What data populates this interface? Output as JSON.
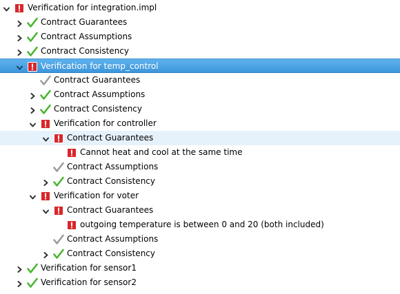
{
  "colors": {
    "selection": "#4aa3e4",
    "hover": "#e6f2fb",
    "error_red": "#d9262a",
    "check_green": "#48b52e",
    "check_gray": "#9c9c9c"
  },
  "rows": [
    {
      "label": "Verification for integration.impl",
      "icon": "error-icon",
      "twisty": "expanded",
      "depth": 0
    },
    {
      "label": "Contract Guarantees",
      "icon": "check-icon",
      "twisty": "collapsed",
      "depth": 1
    },
    {
      "label": "Contract Assumptions",
      "icon": "check-icon",
      "twisty": "collapsed",
      "depth": 1
    },
    {
      "label": "Contract Consistency",
      "icon": "check-icon",
      "twisty": "collapsed",
      "depth": 1
    },
    {
      "label": "Verification for temp_control",
      "icon": "error-icon",
      "twisty": "expanded",
      "depth": 1,
      "state": "selected"
    },
    {
      "label": "Contract Guarantees",
      "icon": "check-gray-icon",
      "twisty": "none",
      "depth": 2
    },
    {
      "label": "Contract Assumptions",
      "icon": "check-icon",
      "twisty": "collapsed",
      "depth": 2
    },
    {
      "label": "Contract Consistency",
      "icon": "check-icon",
      "twisty": "collapsed",
      "depth": 2
    },
    {
      "label": "Verification for controller",
      "icon": "error-icon",
      "twisty": "expanded",
      "depth": 2
    },
    {
      "label": "Contract Guarantees",
      "icon": "error-icon",
      "twisty": "expanded",
      "depth": 3,
      "state": "hover"
    },
    {
      "label": "Cannot heat and cool at the same time",
      "icon": "error-icon",
      "twisty": "none",
      "depth": 4
    },
    {
      "label": "Contract Assumptions",
      "icon": "check-gray-icon",
      "twisty": "none",
      "depth": 3
    },
    {
      "label": "Contract Consistency",
      "icon": "check-icon",
      "twisty": "collapsed",
      "depth": 3
    },
    {
      "label": "Verification for voter",
      "icon": "error-icon",
      "twisty": "expanded",
      "depth": 2
    },
    {
      "label": "Contract Guarantees",
      "icon": "error-icon",
      "twisty": "expanded",
      "depth": 3
    },
    {
      "label": "outgoing temperature is between 0 and 20 (both included)",
      "icon": "error-icon",
      "twisty": "none",
      "depth": 4
    },
    {
      "label": "Contract Assumptions",
      "icon": "check-gray-icon",
      "twisty": "none",
      "depth": 3
    },
    {
      "label": "Contract Consistency",
      "icon": "check-icon",
      "twisty": "collapsed",
      "depth": 3
    },
    {
      "label": "Verification for sensor1",
      "icon": "check-icon",
      "twisty": "collapsed",
      "depth": 1
    },
    {
      "label": "Verification for sensor2",
      "icon": "check-icon",
      "twisty": "collapsed",
      "depth": 1
    }
  ]
}
